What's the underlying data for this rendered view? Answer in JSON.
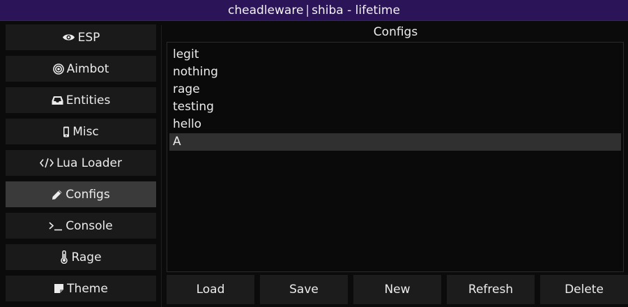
{
  "window": {
    "title_brand": "cheadleware",
    "title_separator": "|",
    "title_rest": "shiba - lifetime"
  },
  "sidebar": {
    "items": [
      {
        "label": "ESP",
        "icon": "eye-icon"
      },
      {
        "label": "Aimbot",
        "icon": "target-icon"
      },
      {
        "label": "Entities",
        "icon": "inbox-icon"
      },
      {
        "label": "Misc",
        "icon": "mobile-icon"
      },
      {
        "label": "Lua Loader",
        "icon": "code-icon"
      },
      {
        "label": "Configs",
        "icon": "pencil-icon",
        "active": true
      },
      {
        "label": "Console",
        "icon": "terminal-icon"
      },
      {
        "label": "Rage",
        "icon": "thermometer-icon"
      },
      {
        "label": "Theme",
        "icon": "note-icon"
      }
    ]
  },
  "configs": {
    "title": "Configs",
    "items": [
      "legit",
      "nothing",
      "rage",
      "testing",
      "hello",
      "A"
    ],
    "selected": "A"
  },
  "buttons": {
    "load": "Load",
    "save": "Save",
    "new": "New",
    "refresh": "Refresh",
    "delete": "Delete"
  },
  "colors": {
    "titlebar": "#2b1457",
    "active_nav": "#3a3a3a",
    "nav_bg": "#1a1a1a",
    "selected_row": "#303030",
    "background": "#0b0b0b"
  }
}
